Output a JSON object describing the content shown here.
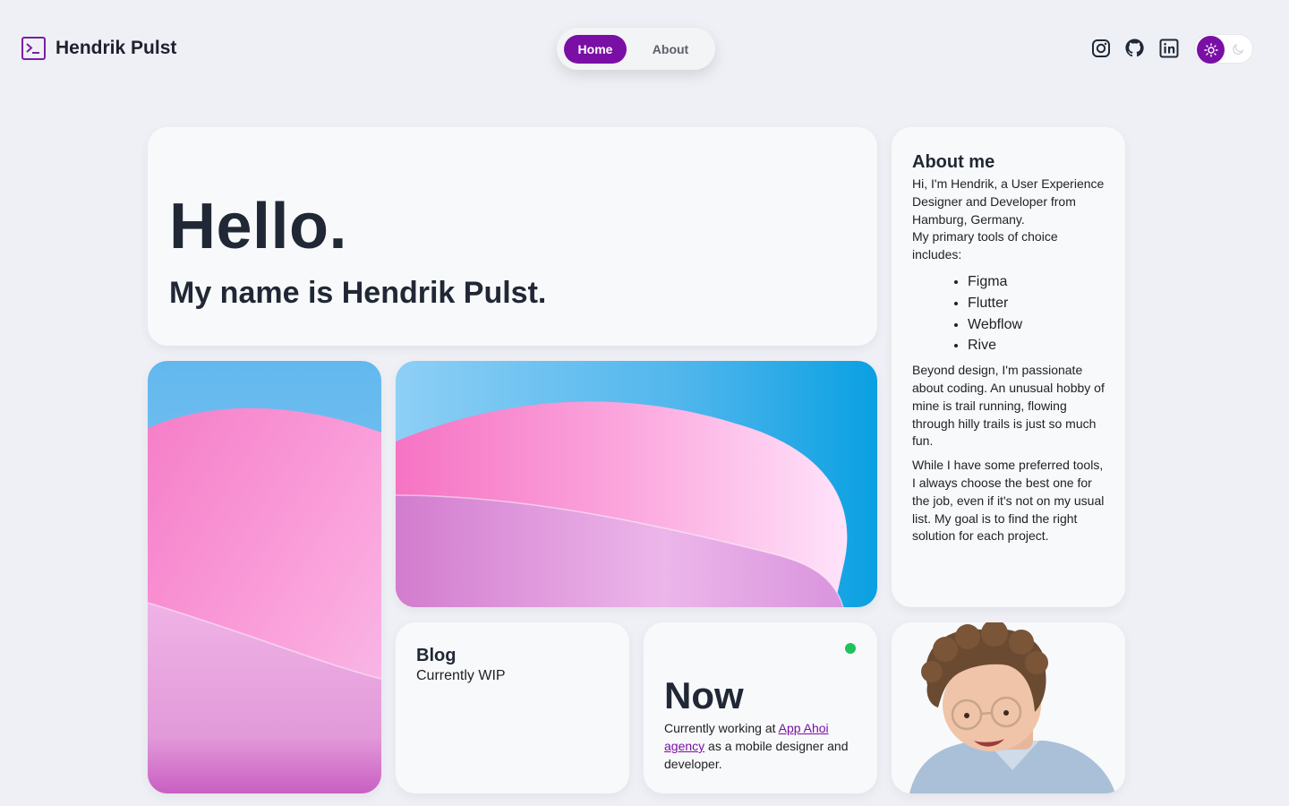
{
  "header": {
    "logo_text": "Hendrik Pulst",
    "logo_icon": "terminal-icon",
    "nav": [
      {
        "label": "Home",
        "active": true
      },
      {
        "label": "About",
        "active": false
      }
    ],
    "socials": [
      "instagram-icon",
      "github-icon",
      "linkedin-icon"
    ],
    "theme_toggle": {
      "selected": "light",
      "icons": [
        "sun-icon",
        "moon-icon"
      ]
    }
  },
  "hero": {
    "greeting": "Hello.",
    "name_line": "My name is Hendrik Pulst."
  },
  "about": {
    "title": "About me",
    "intro": "Hi, I'm Hendrik, a User Experience Designer and Developer from Hamburg, Germany.",
    "tools_intro": "My primary tools of choice includes:",
    "tools": [
      "Figma",
      "Flutter",
      "Webflow",
      "Rive"
    ],
    "paragraph_hobby": "Beyond design, I'm passionate about coding. An unusual hobby of mine is trail running, flowing through hilly trails is just so much fun.",
    "paragraph_tools": "While I have some preferred tools, I always choose the best one for the job, even if it's not on my usual list. My goal is to find the right solution for each project."
  },
  "blog": {
    "title": "Blog",
    "subtitle": "Currently WIP"
  },
  "now": {
    "title": "Now",
    "text_before": "Currently working at ",
    "link_label": "App Ahoi agency",
    "text_after": " as a mobile designer and developer."
  },
  "colors": {
    "accent": "#7a0fa6",
    "background": "#eff0f5",
    "card": "#f8f9fb",
    "status": "#1fc35a"
  }
}
